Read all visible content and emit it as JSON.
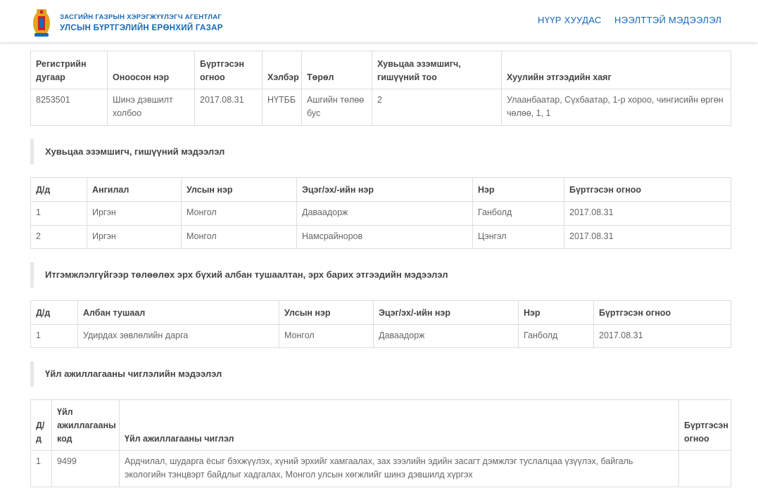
{
  "header": {
    "agency_line1": "ЗАСГИЙН ГАЗРЫН ХЭРЭГЖҮҮЛЭГЧ АГЕНТЛАГ",
    "agency_line2": "УЛСЫН БҮРТГЭЛИЙН ЕРӨНХИЙ ГАЗАР",
    "nav": [
      "НҮҮР ХУУДАС",
      "НЭЭЛТТЭЙ МЭДЭЭЛЭЛ"
    ]
  },
  "entity": {
    "headers": [
      "Регистрийн дугаар",
      "Оноосон нэр",
      "Бүртгэсэн огноо",
      "Хэлбэр",
      "Төрөл",
      "Хувьцаа эзэмшигч, гишүүний тоо",
      "Хуулийн этгээдийн хаяг"
    ],
    "row": [
      "8253501",
      "Шинэ дэвшилт холбоо",
      "2017.08.31",
      "НҮТББ",
      "Ашгийн төлөө бус",
      "2",
      "Улаанбаатар, Сүхбаатар, 1-р хороо, чингисийн өргөн чөлөө, 1, 1"
    ]
  },
  "shareholders": {
    "title": "Хувьцаа эзэмшигч, гишүүний мэдээлэл",
    "headers": [
      "Д/д",
      "Ангилал",
      "Улсын нэр",
      "Эцэг/эх/-ийн нэр",
      "Нэр",
      "Бүртгэсэн огноо"
    ],
    "rows": [
      [
        "1",
        "Иргэн",
        "Монгол",
        "Даваадорж",
        "Ганболд",
        "2017.08.31"
      ],
      [
        "2",
        "Иргэн",
        "Монгол",
        "Намсрайноров",
        "Цэнгэл",
        "2017.08.31"
      ]
    ]
  },
  "officials": {
    "title": "Итгэмжлэлгүйгээр төлөөлөх эрх бүхий албан тушаалтан, эрх барих этгээдийн мэдээлэл",
    "headers": [
      "Д/д",
      "Албан тушаал",
      "Улсын нэр",
      "Эцэг/эх/-ийн нэр",
      "Нэр",
      "Бүртгэсэн огноо"
    ],
    "rows": [
      [
        "1",
        "Удирдах зөвлөлийн дарга",
        "Монгол",
        "Даваадорж",
        "Ганболд",
        "2017.08.31"
      ]
    ]
  },
  "activity": {
    "title": "Үйл ажиллагааны чиглэлийн мэдээлэл",
    "headers": [
      "Д/д",
      "Үйл ажиллагааны код",
      "Үйл ажиллагааны чиглэл",
      "Бүртгэсэн огноо"
    ],
    "rows": [
      [
        "1",
        "9499",
        "Ардчилал, шударга ёсыг бэхжүүлэх, хүний эрхийг хамгаалах, зах зээлийн эдийн засагт дэмжлэг туслалцаа үзүүлэх, байгаль экологийн тэнцвэрт байдлыг хадгалах, Монгол улсын хөгжлийг шинэ дэвшилд хүргэх",
        ""
      ]
    ]
  },
  "colors": {
    "brand": "#1668b7",
    "gold": "#e0a51f",
    "red": "#c8202f"
  }
}
